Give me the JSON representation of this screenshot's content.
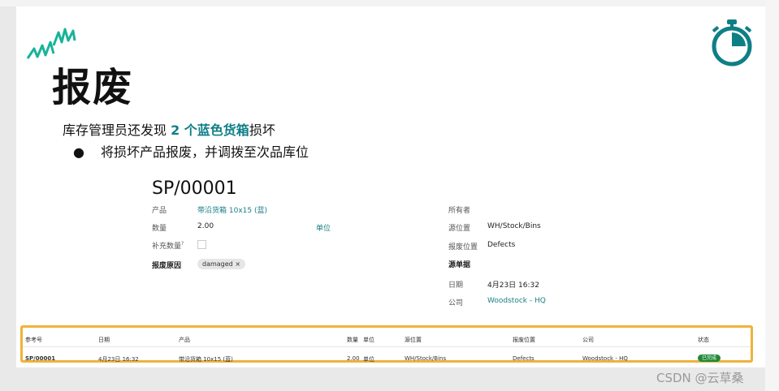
{
  "slide": {
    "title": "报废",
    "subtitle_pre": "库存管理员还发现 ",
    "subtitle_highlight": "2 个蓝色货箱",
    "subtitle_post": "损坏",
    "bullet": "将损坏产品报废，并调拨至次品库位"
  },
  "form": {
    "ref": "SP/00001",
    "product_label": "产品",
    "product_value": "带沿货箱 10x15 (蓝)",
    "qty_label": "数量",
    "qty_value": "2.00",
    "unit_label": "单位",
    "replenish_label": "补充数量",
    "replenish_help": "?",
    "reason_label": "报废原因",
    "reason_tag": "damaged",
    "reason_tag_close": "×",
    "owner_label": "所有者",
    "source_label": "源位置",
    "source_value": "WH/Stock/Bins",
    "scrap_loc_label": "报废位置",
    "scrap_loc_value": "Defects",
    "source_doc_label": "源单据",
    "date_label": "日期",
    "date_value": "4月23日 16:32",
    "company_label": "公司",
    "company_value": "Woodstock - HQ"
  },
  "table": {
    "headers": [
      "参考号",
      "日期",
      "产品",
      "数量",
      "单位",
      "源位置",
      "报废位置",
      "公司",
      "状态"
    ],
    "row": {
      "ref": "SP/00001",
      "date": "4月23日 16:32",
      "product": "带沿货箱 10x15 (蓝)",
      "qty": "2.00",
      "unit": "单位",
      "source": "WH/Stock/Bins",
      "scrap_loc": "Defects",
      "company": "Woodstock - HQ",
      "status": "已完成"
    }
  },
  "watermark": "CSDN @云草桑",
  "colors": {
    "accent": "#0f7f86",
    "highlight_border": "#f0b23b",
    "status_done": "#1f8a3a",
    "spark": "#19b39a"
  }
}
